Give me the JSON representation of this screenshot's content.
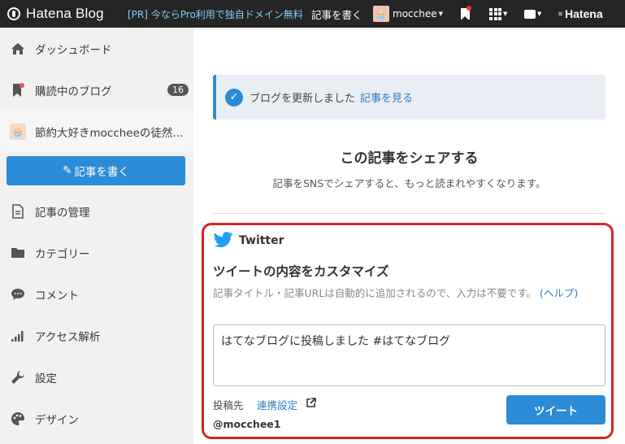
{
  "topbar": {
    "logo": "Hatena Blog",
    "pr_text": "[PR] 今ならPro利用で独自ドメイン無料",
    "write": "記事を書く",
    "user": "mocchee",
    "hatena": "Hatena"
  },
  "sidebar": {
    "items": [
      {
        "label": "ダッシュボード",
        "icon": "home-icon"
      },
      {
        "label": "購読中のブログ",
        "icon": "bookmark-icon",
        "count": "16"
      },
      {
        "label": "節約大好きmoccheeの徒然...",
        "icon": "blog-avatar-icon"
      },
      {
        "label": "記事の管理",
        "icon": "document-icon"
      },
      {
        "label": "カテゴリー",
        "icon": "folder-icon"
      },
      {
        "label": "コメント",
        "icon": "comment-icon"
      },
      {
        "label": "アクセス解析",
        "icon": "signal-icon"
      },
      {
        "label": "設定",
        "icon": "wrench-icon"
      },
      {
        "label": "デザイン",
        "icon": "palette-icon"
      }
    ],
    "write_button": "記事を書く"
  },
  "notice": {
    "text": "ブログを更新しました",
    "link": "記事を見る"
  },
  "share": {
    "title": "この記事をシェアする",
    "subtitle": "記事をSNSでシェアすると、もっと読まれやすくなります。"
  },
  "twitter": {
    "label": "Twitter",
    "heading": "ツイートの内容をカスタマイズ",
    "desc": "記事タイトル・記事URLは自動的に追加されるので、入力は不要です。",
    "help": "(ヘルプ)",
    "tweet_text": "はてなブログに投稿しました #はてなブログ",
    "dest_label": "投稿先",
    "dest_link": "連携設定",
    "account": "@mocchee1",
    "tweet_button": "ツイート"
  },
  "colors": {
    "accent": "#2c8bd6",
    "highlight_border": "#d9232a",
    "topbar": "#252525"
  }
}
